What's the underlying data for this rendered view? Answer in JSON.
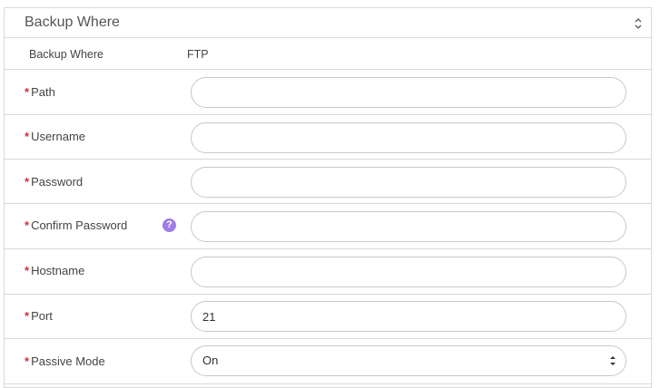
{
  "section": {
    "title": "Backup Where",
    "collapse_icon": "chevron-double-up-icon"
  },
  "info_row": {
    "label": "Backup Where",
    "value": "FTP"
  },
  "fields": {
    "path": {
      "label": "Path",
      "value": ""
    },
    "username": {
      "label": "Username",
      "value": ""
    },
    "password": {
      "label": "Password",
      "value": ""
    },
    "confirm_password": {
      "label": "Confirm Password",
      "value": "",
      "help_icon": "question-icon"
    },
    "hostname": {
      "label": "Hostname",
      "value": ""
    },
    "port": {
      "label": "Port",
      "value": "21"
    },
    "passive_mode": {
      "label": "Passive Mode",
      "selected": "On"
    }
  },
  "required_marker": "*",
  "colors": {
    "required": "#d32f2f",
    "help_icon": "#a07ce6",
    "border": "#d9d9d9"
  }
}
